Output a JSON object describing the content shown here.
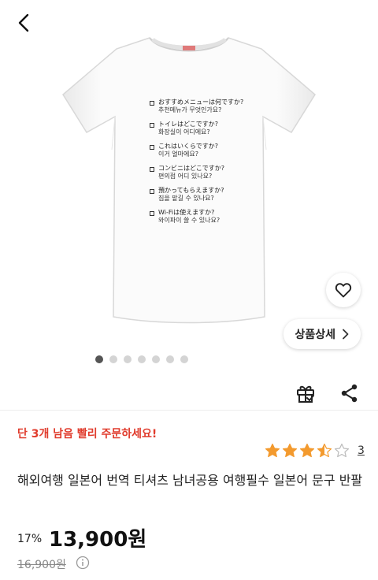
{
  "nav": {
    "back_icon": "chevron-left-icon"
  },
  "product_image": {
    "print_items": [
      {
        "jp": "おすすめメニューは何ですか?",
        "ko": "추천메뉴가 무엇인가요?"
      },
      {
        "jp": "トイレはどこですか?",
        "ko": "화장실이 어디에요?"
      },
      {
        "jp": "これはいくらですか?",
        "ko": "이거 얼마에요?"
      },
      {
        "jp": "コンビニはどこですか?",
        "ko": "편의점 어디 있나요?"
      },
      {
        "jp": "預かってもらえますか?",
        "ko": "짐을 맡길 수 있나요?"
      },
      {
        "jp": "Wi-Fiは使えますか?",
        "ko": "와이파이 쓸 수 있나요?"
      }
    ],
    "carousel_pages": 7,
    "active_page": 1
  },
  "actions": {
    "like_icon": "heart-icon",
    "detail_label": "상품상세",
    "gift_icon": "gift-icon",
    "share_icon": "share-icon"
  },
  "product": {
    "stock_message": "단 3개 남음 빨리 주문하세요!",
    "rating": 3.5,
    "rating_max": 5,
    "review_count": "3",
    "title": "해외여행 일본어 번역 티셔츠 남녀공용 여행필수 일본어 문구 반팔",
    "discount": "17%",
    "price": "13,900원",
    "original_price": "16,900원"
  },
  "colors": {
    "stock_message": "#e03b2c",
    "star": "#f39a2e",
    "dot_active": "#555555",
    "dot_inactive": "#d4d4d4"
  }
}
